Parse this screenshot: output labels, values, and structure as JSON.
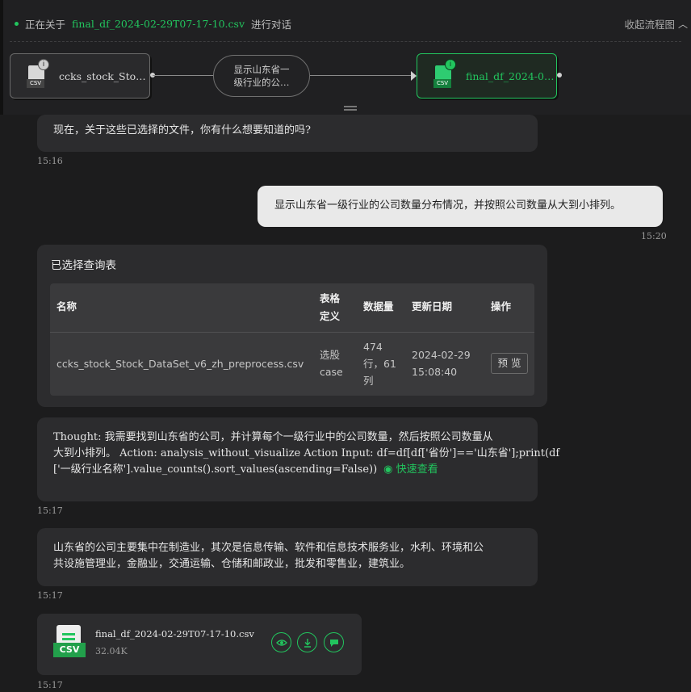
{
  "header": {
    "prefix": "正在关于",
    "file": "final_df_2024-02-29T07-17-10.csv",
    "suffix": "进行对话",
    "collapse_label": "收起流程图",
    "collapse_icon": "chevron-up-icon"
  },
  "flow": {
    "source_label": "ccks_stock_Sto…",
    "source_badge": "CSV",
    "source_info": "i",
    "step_line1": "显示山东省一",
    "step_line2": "级行业的公…",
    "target_label": "final_df_2024-0…",
    "target_badge": "CSV",
    "target_info": "i"
  },
  "messages": {
    "partial": "现在，关于这些已选择的文件，你有什么想要知道的吗?",
    "partial_time": "15:16",
    "user_text": "显示山东省一级行业的公司数量分布情况，并按照公司数量从大到小排列。",
    "user_time": "15:20",
    "query_title": "已选择查询表",
    "table": {
      "headers": [
        "名称",
        "表格定义",
        "数据量",
        "更新日期",
        "操作"
      ],
      "row": {
        "name": "ccks_stock_Stock_DataSet_v6_zh_preprocess.csv",
        "def_line1": "选股",
        "def_line2": "case",
        "size_line1": "474",
        "size_line2": "行，61",
        "size_line3": "列",
        "date_line1": "2024-02-29",
        "date_line2": "15:08:40",
        "action": "预 览"
      }
    },
    "thought_line1": "Thought: 我需要找到山东省的公司，并计算每个一级行业中的公司数量，然后按照公司数量从",
    "thought_line2": "大到小排列。 Action: analysis_without_visualize Action Input: df=df[df['省份']=='山东省'];print(df",
    "thought_line3": "['一级行业名称'].value_counts().sort_values(ascending=False))",
    "quick_view": "快速查看",
    "thought_time": "15:17",
    "answer_line1": "山东省的公司主要集中在制造业，其次是信息传输、软件和信息技术服务业，水利、环境和公",
    "answer_line2": "共设施管理业，金融业，交通运输、仓储和邮政业，批发和零售业，建筑业。",
    "answer_time": "15:17",
    "file_name": "final_df_2024-02-29T07-17-10.csv",
    "file_size": "32.04K",
    "file_badge": "CSV",
    "file_time": "15:17"
  },
  "colors": {
    "accent": "#22c55e",
    "background": "#1c1c1d",
    "bubble": "#2c2c2e",
    "user_bubble": "#e9e9e9"
  }
}
